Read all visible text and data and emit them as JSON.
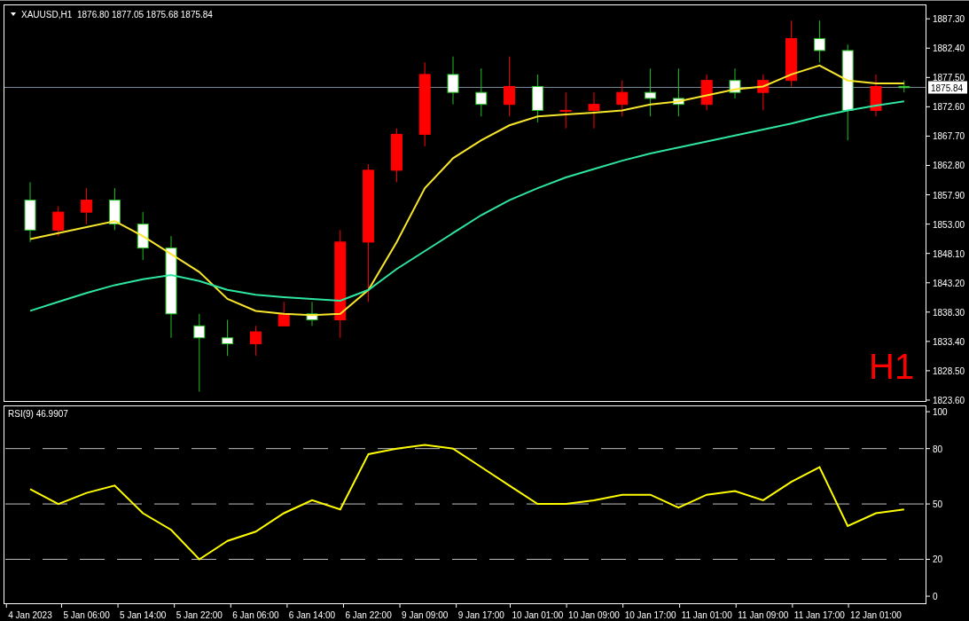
{
  "chart_window": {
    "symbol": "XAUUSD,H1",
    "ohlc": "1876.80 1877.05 1875.68 1875.84",
    "timeframe_label": "H1",
    "chart_data": {
      "type": "candlestick",
      "ylim": [
        1823.3,
        1889.7
      ],
      "ref_lines": [
        {
          "axis": "y",
          "value": 1875.84,
          "label": "1875.84"
        }
      ],
      "yticks": [
        {
          "value": 1887.3,
          "label": "1887.30"
        },
        {
          "value": 1882.4,
          "label": "1882.40"
        },
        {
          "value": 1877.5,
          "label": "1877.50"
        },
        {
          "value": 1872.6,
          "label": "1872.60"
        },
        {
          "value": 1867.7,
          "label": "1867.70"
        },
        {
          "value": 1862.8,
          "label": "1862.80"
        },
        {
          "value": 1857.9,
          "label": "1857.90"
        },
        {
          "value": 1853,
          "label": "1853.00"
        },
        {
          "value": 1848.1,
          "label": "1848.10"
        },
        {
          "value": 1843.2,
          "label": "1843.20"
        },
        {
          "value": 1838.3,
          "label": "1838.30"
        },
        {
          "value": 1833.4,
          "label": "1833.40"
        },
        {
          "value": 1828.5,
          "label": "1828.50"
        },
        {
          "value": 1823.6,
          "label": "1823.60"
        }
      ],
      "categories": [
        null,
        null,
        null,
        null,
        null,
        null,
        null,
        null,
        null,
        null,
        null,
        null,
        null,
        null,
        null,
        null,
        null,
        null,
        null,
        null,
        null,
        null,
        null,
        null,
        null,
        null,
        null,
        null,
        null,
        null,
        null,
        null
      ],
      "ohlc": [
        [
          1857,
          1860,
          1850,
          1852
        ],
        [
          1852,
          1856,
          1851,
          1855
        ],
        [
          1855,
          1859,
          1853,
          1857
        ],
        [
          1857,
          1859,
          1852,
          1853
        ],
        [
          1853,
          1855,
          1847,
          1849
        ],
        [
          1849,
          1851,
          1834,
          1838
        ],
        [
          1836,
          1838,
          1825,
          1834
        ],
        [
          1834,
          1837,
          1831,
          1833
        ],
        [
          1833,
          1836,
          1831,
          1835
        ],
        [
          1836,
          1840,
          1836,
          1838
        ],
        [
          1838,
          1840,
          1836,
          1837
        ],
        [
          1837,
          1852,
          1834,
          1850
        ],
        [
          1850,
          1863,
          1840,
          1862
        ],
        [
          1862,
          1869,
          1860,
          1868
        ],
        [
          1868,
          1880,
          1866,
          1878
        ],
        [
          1878,
          1881,
          1873,
          1875
        ],
        [
          1875,
          1879,
          1871,
          1873
        ],
        [
          1873,
          1881,
          1871,
          1876
        ],
        [
          1876,
          1878,
          1870,
          1872
        ],
        [
          1872,
          1875,
          1869,
          1872
        ],
        [
          1872,
          1875,
          1869,
          1873
        ],
        [
          1873,
          1877,
          1871,
          1875
        ],
        [
          1875,
          1879,
          1871,
          1874
        ],
        [
          1874,
          1879,
          1871,
          1873
        ],
        [
          1873,
          1878,
          1872,
          1877
        ],
        [
          1877,
          1879,
          1874,
          1875
        ],
        [
          1875,
          1878,
          1872,
          1877
        ],
        [
          1877,
          1887,
          1876,
          1884
        ],
        [
          1884,
          1887,
          1880,
          1882
        ],
        [
          1882,
          1883,
          1867,
          1872
        ],
        [
          1872,
          1878,
          1871,
          1876
        ],
        [
          1876,
          1877,
          1875,
          1875.8
        ]
      ],
      "series": [
        {
          "type": "line",
          "color": "#f7e62b",
          "values": [
            1850.5,
            1851.5,
            1852.5,
            1853.5,
            1851,
            1848,
            1845,
            1840.5,
            1838.5,
            1838,
            1837.8,
            1838,
            1842,
            1850,
            1859,
            1864,
            1867,
            1869.5,
            1871,
            1871.3,
            1871.6,
            1872,
            1873,
            1873.5,
            1874.5,
            1875.5,
            1876,
            1878,
            1879.5,
            1877,
            1876.5,
            1876.5
          ]
        },
        {
          "type": "line",
          "color": "#2ee6a0",
          "values": [
            1838.5,
            1840,
            1841.5,
            1842.8,
            1843.8,
            1844.5,
            1843.5,
            1842,
            1841.2,
            1840.8,
            1840.5,
            1840.2,
            1842,
            1845.5,
            1848.5,
            1851.5,
            1854.5,
            1857,
            1859,
            1860.8,
            1862.2,
            1863.6,
            1864.8,
            1865.8,
            1866.8,
            1867.8,
            1868.8,
            1869.8,
            1871,
            1872,
            1872.8,
            1873.5
          ]
        }
      ]
    }
  },
  "rsi_panel": {
    "title": "RSI(9) 46.9907",
    "chart_data": {
      "type": "line",
      "ylim": [
        -4.3,
        103.4
      ],
      "grid": true,
      "yticks": [
        0,
        20,
        50,
        80,
        100
      ],
      "categories": [
        "4 Jan 2023",
        null,
        "5 Jan 06:00",
        null,
        "5 Jan 14:00",
        null,
        "5 Jan 22:00",
        null,
        "6 Jan 06:00",
        null,
        "6 Jan 14:00",
        null,
        "6 Jan 22:00",
        null,
        "9 Jan 09:00",
        null,
        "9 Jan 17:00",
        null,
        "10 Jan 01:00",
        null,
        "10 Jan 09:00",
        null,
        "10 Jan 17:00",
        null,
        "11 Jan 01:00",
        null,
        "11 Jan 09:00",
        null,
        "11 Jan 17:00",
        null,
        "12 Jan 01:00",
        null
      ],
      "series": [
        {
          "color": "#ffff00",
          "values": [
            58,
            50,
            56,
            60,
            45,
            36,
            20,
            30,
            35,
            45,
            52,
            47,
            77,
            80,
            82,
            80,
            70,
            60,
            50,
            50,
            52,
            55,
            55,
            48,
            55,
            57,
            52,
            62,
            70,
            38,
            45,
            47
          ]
        }
      ]
    }
  }
}
